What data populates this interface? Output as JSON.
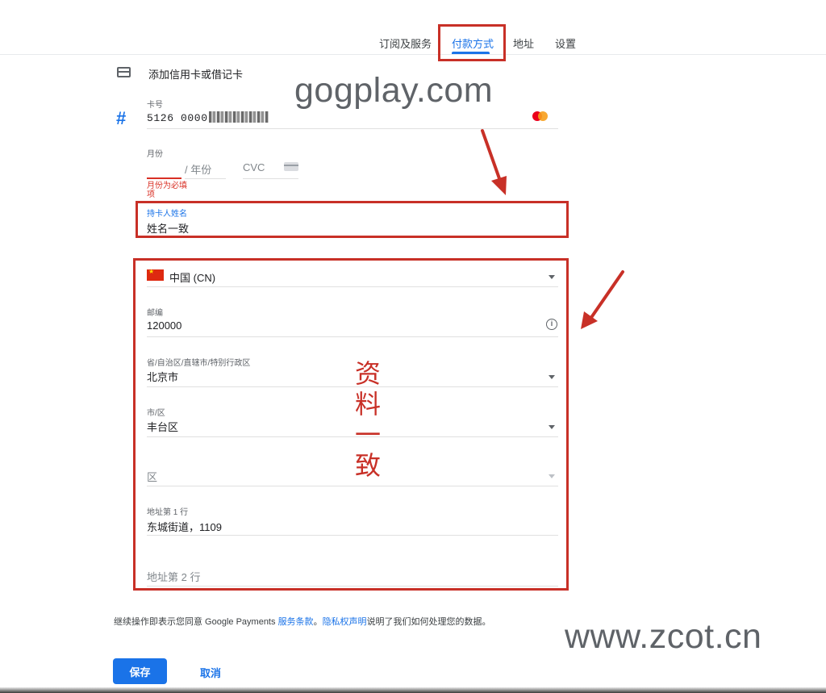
{
  "nav": {
    "tabs": [
      {
        "label": "订阅及服务"
      },
      {
        "label": "付款方式"
      },
      {
        "label": "地址"
      },
      {
        "label": "设置"
      }
    ],
    "active_tab": "付款方式"
  },
  "form": {
    "title": "添加信用卡或借记卡",
    "card_number": {
      "label": "卡号",
      "value_prefix": "5126 0000",
      "network_icon": "mastercard-icon"
    },
    "expiry": {
      "month_label": "月份",
      "year_placeholder": "/ 年份",
      "month_error": "月份为必填项"
    },
    "cvc": {
      "placeholder": "CVC"
    },
    "cardholder": {
      "label": "持卡人姓名",
      "value": "姓名一致"
    },
    "country": {
      "value": "中国 (CN)"
    },
    "postal_code": {
      "label": "邮编",
      "value": "120000"
    },
    "province": {
      "label": "省/自治区/直辖市/特别行政区",
      "value": "北京市"
    },
    "city": {
      "label": "市/区",
      "value": "丰台区"
    },
    "district": {
      "placeholder": "区"
    },
    "address_line1": {
      "label": "地址第 1 行",
      "value": "东城街道，1109"
    },
    "address_line2": {
      "placeholder": "地址第 2 行"
    }
  },
  "annotations": {
    "watermark_top": "gogplay.com",
    "watermark_bottom": "www.zcot.cn",
    "vertical_chars": [
      "资",
      "料",
      "一",
      "致"
    ],
    "color": "#c83027"
  },
  "terms": {
    "prefix": "继续操作即表示您同意 Google Payments ",
    "terms_link": "服务条款",
    "sep": "。",
    "privacy_link": "隐私权声明",
    "suffix": "说明了我们如何处理您的数据。"
  },
  "actions": {
    "save": "保存",
    "cancel": "取消"
  },
  "colors": {
    "accent": "#1a73e8",
    "error": "#d93025"
  }
}
